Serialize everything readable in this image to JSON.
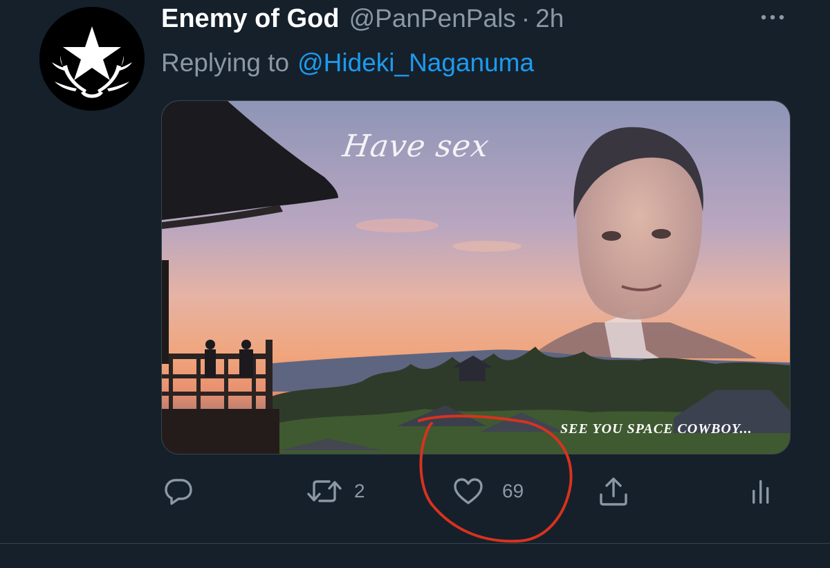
{
  "tweet": {
    "author_name": "Enemy of God",
    "author_handle": "@PanPenPals",
    "separator": "·",
    "time": "2h",
    "replying_prefix": "Replying to",
    "replying_to": "@Hideki_Naganuma",
    "media": {
      "overlay_text_top": "Have sex",
      "overlay_text_bottom": "SEE YOU SPACE COWBOY..."
    },
    "actions": {
      "reply_icon": "reply-bubble-icon",
      "retweet_icon": "retweet-icon",
      "retweet_count": "2",
      "like_icon": "heart-icon",
      "like_count": "69",
      "share_icon": "share-upload-icon",
      "analytics_icon": "analytics-bars-icon"
    },
    "more_icon": "more-dots-icon"
  },
  "colors": {
    "background": "#15202b",
    "secondary_text": "#8b98a5",
    "link": "#1d9bf0",
    "annotation_circle": "#d7321e"
  }
}
